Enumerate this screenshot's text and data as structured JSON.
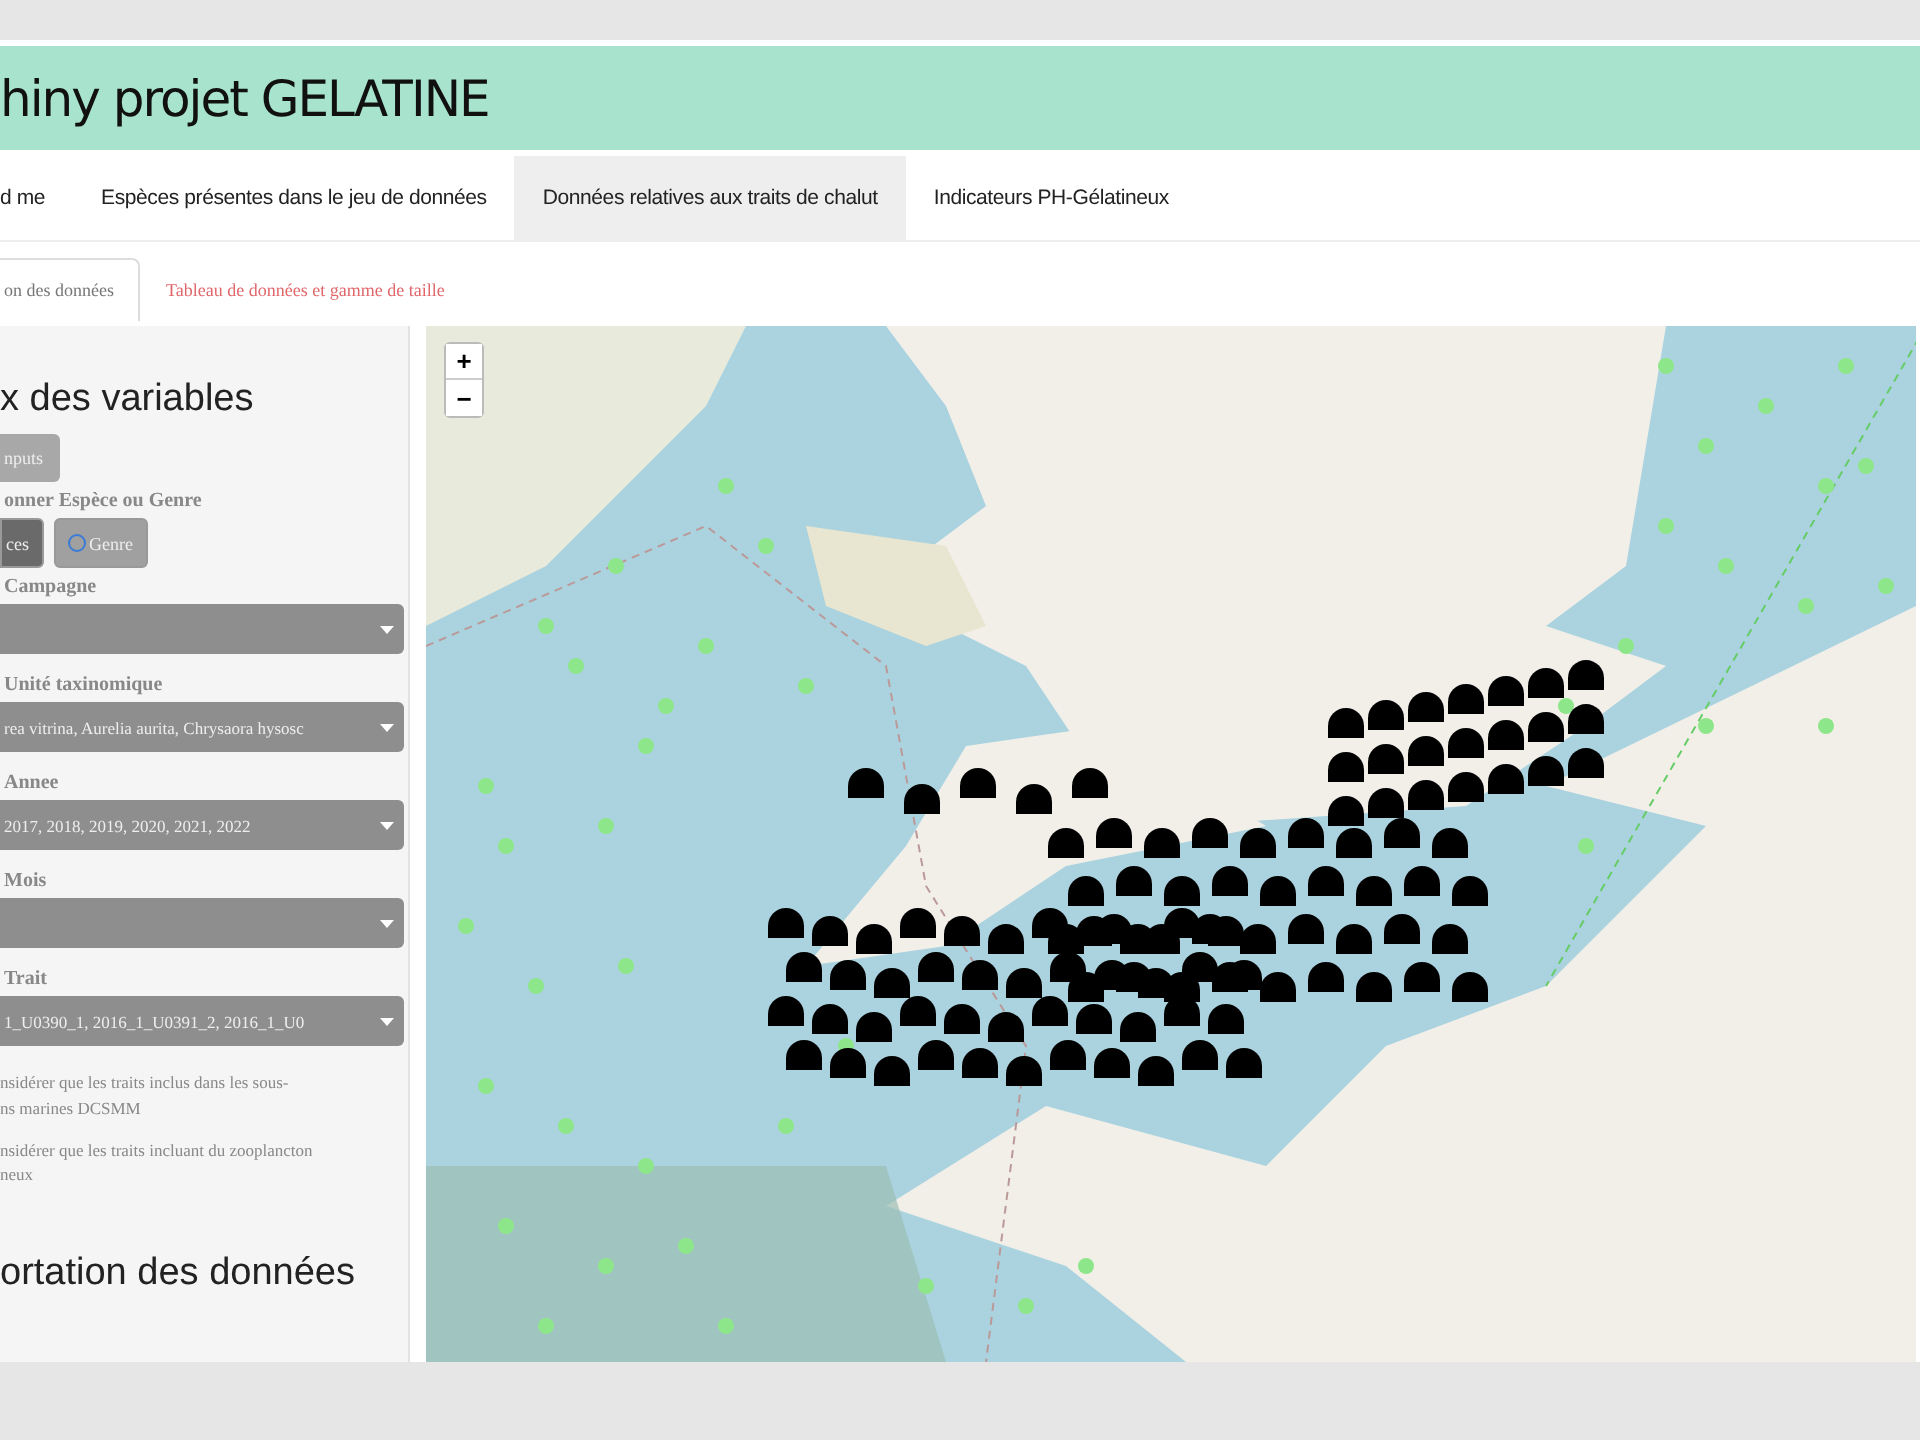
{
  "header": {
    "title": "hiny projet GELATINE"
  },
  "tabs": [
    {
      "label": "d me",
      "selected": false
    },
    {
      "label": "Espèces présentes dans le jeu de données",
      "selected": false
    },
    {
      "label": "Données relatives aux traits de chalut",
      "selected": true
    },
    {
      "label": "Indicateurs PH-Gélatineux",
      "selected": false
    }
  ],
  "subtabs": [
    {
      "label": "on des données",
      "selected": true
    },
    {
      "label": "Tableau de données et gamme de taille",
      "selected": false
    }
  ],
  "sidebar": {
    "heading": "x des variables",
    "reset_button": "nputs",
    "choice_label": "onner Espèce ou Genre",
    "radios": [
      {
        "label": "ces",
        "selected": true
      },
      {
        "label": "Genre",
        "selected": false
      }
    ],
    "selects": [
      {
        "label": "Campagne"
      },
      {
        "label": "Unité taxinomique",
        "value": "rea vitrina, Aurelia aurita, Chrysaora hysosc"
      },
      {
        "label": "Annee",
        "value": "2017, 2018, 2019, 2020, 2021, 2022"
      },
      {
        "label": "Mois"
      },
      {
        "label": "Trait",
        "value": "1_U0390_1, 2016_1_U0391_2, 2016_1_U0"
      }
    ],
    "checkboxes": [
      {
        "lines": [
          "nsidérer que les traits inclus dans les sous-",
          "ns marines DCSMM"
        ]
      },
      {
        "lines": [
          "nsidérer que les traits incluant du zooplancton",
          "neux"
        ]
      }
    ],
    "export_heading": "ortation des données"
  },
  "map": {
    "zoom_in": "+",
    "zoom_out": "−"
  }
}
